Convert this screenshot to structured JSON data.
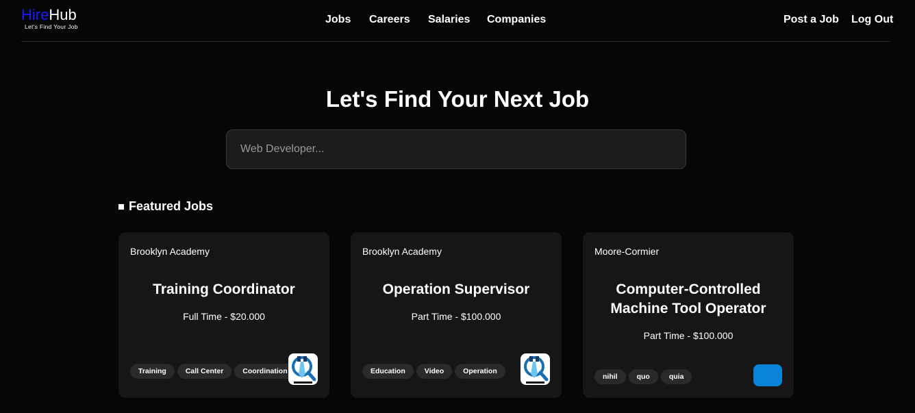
{
  "brand": {
    "name_part1": "Hire",
    "name_part2": "Hub",
    "tagline": "Let's Find Your Job",
    "accent": "#1a1aff"
  },
  "nav": {
    "links": [
      "Jobs",
      "Careers",
      "Salaries",
      "Companies"
    ],
    "post_job": "Post a Job",
    "logout": "Log Out"
  },
  "hero": {
    "title": "Let's Find Your Next Job"
  },
  "search": {
    "placeholder": "Web Developer...",
    "value": ""
  },
  "featured": {
    "title": "Featured Jobs",
    "jobs": [
      {
        "company": "Brooklyn Academy",
        "title": "Training Coordinator",
        "meta": "Full Time - $20.000",
        "tags": [
          "Training",
          "Call Center",
          "Coordination"
        ],
        "logo": "magnifier-tie-logo"
      },
      {
        "company": "Brooklyn Academy",
        "title": "Operation Supervisor",
        "meta": "Part Time - $100.000",
        "tags": [
          "Education",
          "Video",
          "Operation"
        ],
        "logo": "magnifier-tie-logo"
      },
      {
        "company": "Moore-Cormier",
        "title": "Computer-Controlled Machine Tool Operator",
        "meta": "Part Time - $100.000",
        "tags": [
          "nihil",
          "quo",
          "quia"
        ],
        "logo": "blue-placeholder-logo"
      }
    ]
  }
}
